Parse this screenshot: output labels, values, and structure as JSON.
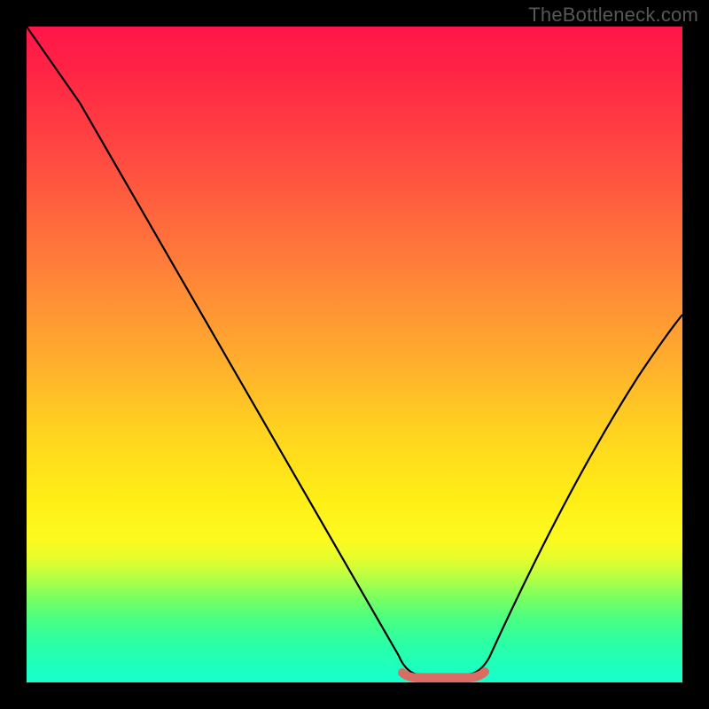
{
  "watermark": "TheBottleneck.com",
  "chart_data": {
    "type": "line",
    "title": "",
    "xlabel": "",
    "ylabel": "",
    "xlim": [
      0,
      100
    ],
    "ylim": [
      0,
      100
    ],
    "grid": false,
    "legend": false,
    "x": [
      0,
      5,
      10,
      15,
      20,
      25,
      30,
      35,
      40,
      45,
      50,
      55,
      58,
      60,
      65,
      68,
      70,
      75,
      80,
      85,
      90,
      95,
      100
    ],
    "y": [
      100,
      93,
      86,
      79,
      72,
      64,
      56,
      48,
      39,
      30,
      21,
      11,
      4,
      0,
      0,
      0,
      4,
      16,
      28,
      38,
      47,
      55,
      62
    ],
    "notes": "V-shaped curve with flat minimum segment roughly between x≈58 and x≈68 near y=0; right branch rises with slight concave-down curvature; heat-map style vertical gradient background from red (top) through orange/yellow to green (bottom); short salmon-colored horizontal stroke marks the flat minimum."
  },
  "colors": {
    "background_black": "#000000",
    "gradient_top": "#ff1549",
    "gradient_mid": "#ffee16",
    "gradient_bottom": "#16ffce",
    "min_marker": "#d96d63",
    "curve": "#000000",
    "watermark": "#575757"
  }
}
